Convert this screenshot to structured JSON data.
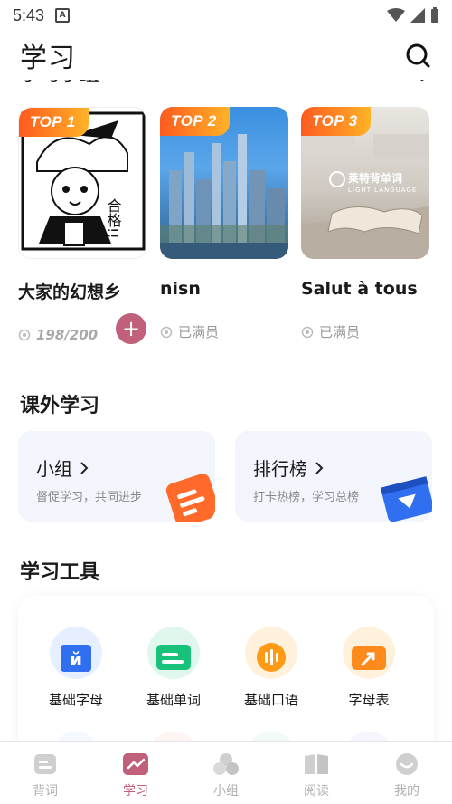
{
  "status_bar": {
    "time": "5:43",
    "app_icon_glyph": "A"
  },
  "header": {
    "title": "学习",
    "search_icon": "search-icon"
  },
  "top_groups": {
    "clipped_title": "学习小组",
    "items": [
      {
        "badge": "TOP 1",
        "name": "大家的幻想乡",
        "members": "198/200",
        "join_label": "+",
        "thumb_text": "合格!!"
      },
      {
        "badge": "TOP 2",
        "name": "nisn",
        "status": "已满员"
      },
      {
        "badge": "TOP 3",
        "name": "Salut à tous",
        "status": "已满员",
        "watermark_title": "莱特背单词",
        "watermark_sub": "LIGHT LANGUAGE"
      }
    ]
  },
  "extracurricular": {
    "title": "课外学习",
    "cards": [
      {
        "title": "小组",
        "desc": "督促学习，共同进步",
        "accent": "#ff6a2a"
      },
      {
        "title": "排行榜",
        "desc": "打卡热榜，学习总榜",
        "accent": "#2f6ff0"
      }
    ]
  },
  "tools": {
    "title": "学习工具",
    "items": [
      {
        "label": "基础字母",
        "glyph": "й",
        "color": "#2f6ff0",
        "bg": "#e6efff"
      },
      {
        "label": "基础单词",
        "color": "#18c27a",
        "bg": "#dff7ec"
      },
      {
        "label": "基础口语",
        "color": "#ff9a16",
        "bg": "#fff1dc"
      },
      {
        "label": "字母表",
        "color": "#ff8a1c",
        "bg": "#fff1dc"
      }
    ]
  },
  "bottom_nav": {
    "items": [
      {
        "label": "背词"
      },
      {
        "label": "学习",
        "active": true
      },
      {
        "label": "小组"
      },
      {
        "label": "阅读"
      },
      {
        "label": "我的"
      }
    ]
  },
  "colors": {
    "accent": "#c1607a",
    "badge_gradient": [
      "#ff5a1f",
      "#ffb327"
    ]
  }
}
